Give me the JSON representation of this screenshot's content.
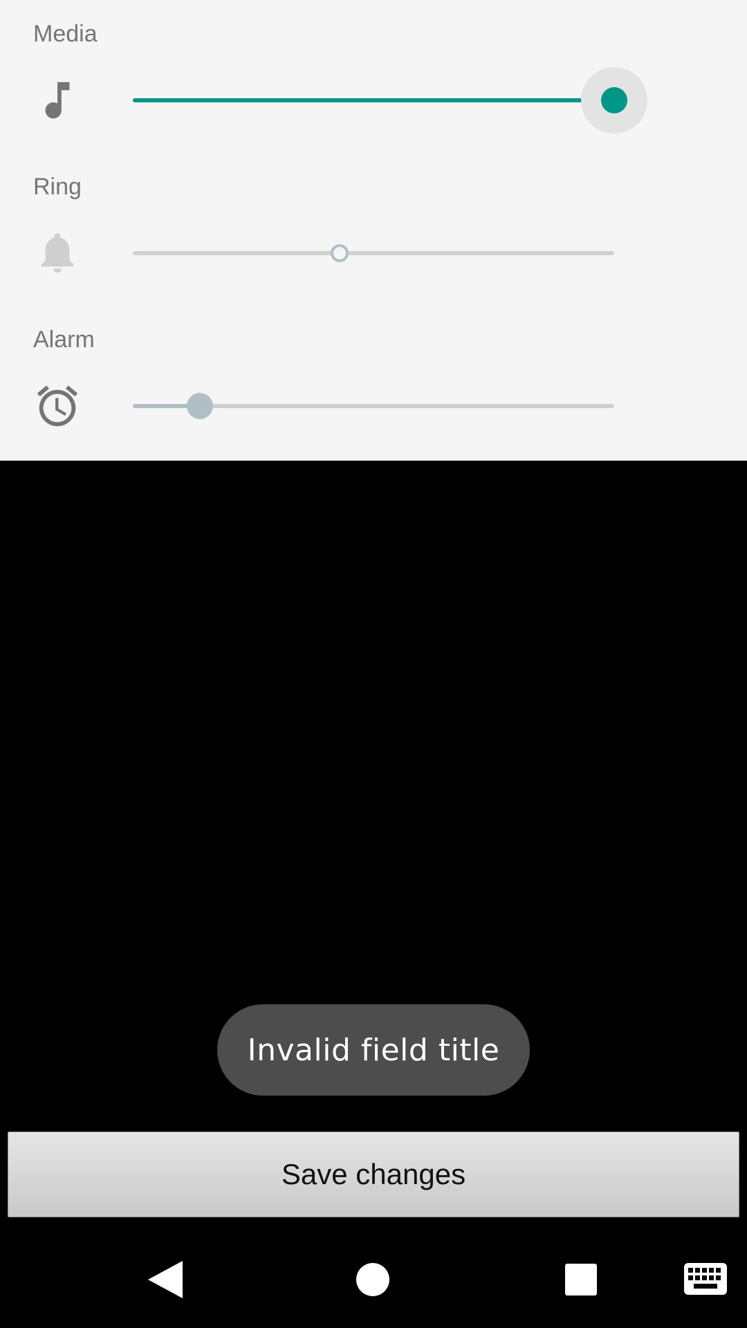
{
  "volumes": {
    "media": {
      "label": "Media",
      "icon": "music-note-icon",
      "level": 1.0,
      "accent": "#009688"
    },
    "ring": {
      "label": "Ring",
      "icon": "bell-icon",
      "level": 0.43
    },
    "alarm": {
      "label": "Alarm",
      "icon": "alarm-clock-icon",
      "level": 0.14,
      "accent": "#b0bec5"
    }
  },
  "toast": {
    "message": "Invalid field title"
  },
  "save_button": {
    "label": "Save changes"
  },
  "nav": {
    "back": "back-icon",
    "home": "home-icon",
    "recents": "recents-icon",
    "keyboard": "keyboard-icon"
  }
}
